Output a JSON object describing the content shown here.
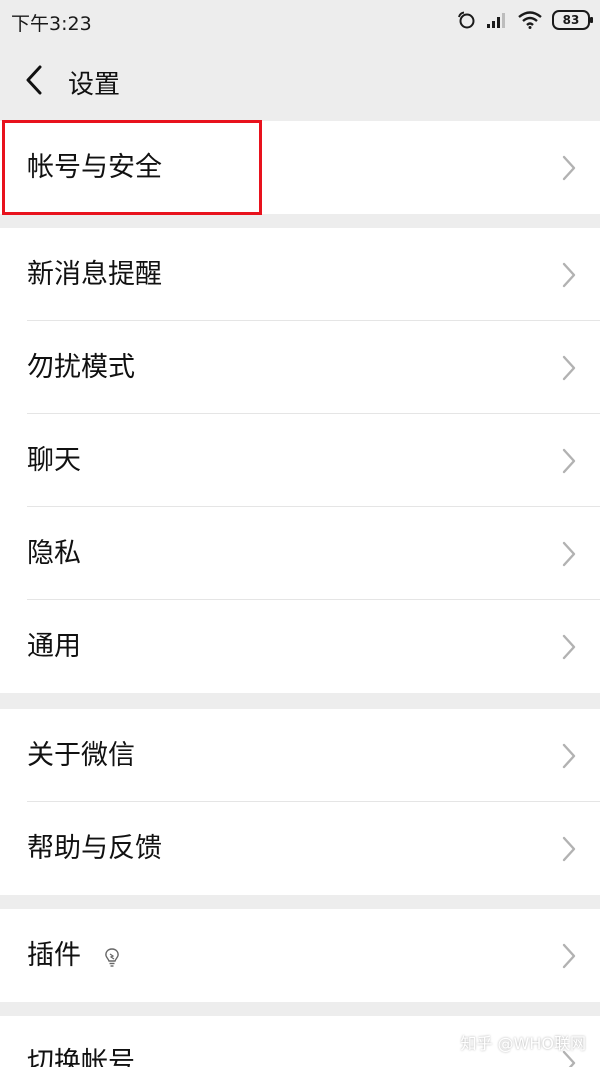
{
  "status_bar": {
    "time": "下午3:23",
    "battery": "83",
    "icons": [
      "alarm-icon",
      "signal-icon",
      "wifi-icon",
      "battery-icon"
    ]
  },
  "header": {
    "title": "设置",
    "back_icon": "chevron-left-icon"
  },
  "groups": [
    {
      "items": [
        {
          "label": "帐号与安全"
        }
      ]
    },
    {
      "items": [
        {
          "label": "新消息提醒"
        },
        {
          "label": "勿扰模式"
        },
        {
          "label": "聊天"
        },
        {
          "label": "隐私"
        },
        {
          "label": "通用"
        }
      ]
    },
    {
      "items": [
        {
          "label": "关于微信"
        },
        {
          "label": "帮助与反馈"
        }
      ]
    },
    {
      "items": [
        {
          "label": "插件"
        }
      ]
    },
    {
      "items": [
        {
          "label": "切换帐号"
        }
      ]
    }
  ],
  "watermark": "知乎 @WHO联网",
  "colors": {
    "background": "#ededed",
    "row_background": "#ffffff",
    "highlight_border": "#e8121d",
    "chevron": "#b2b2b2"
  }
}
